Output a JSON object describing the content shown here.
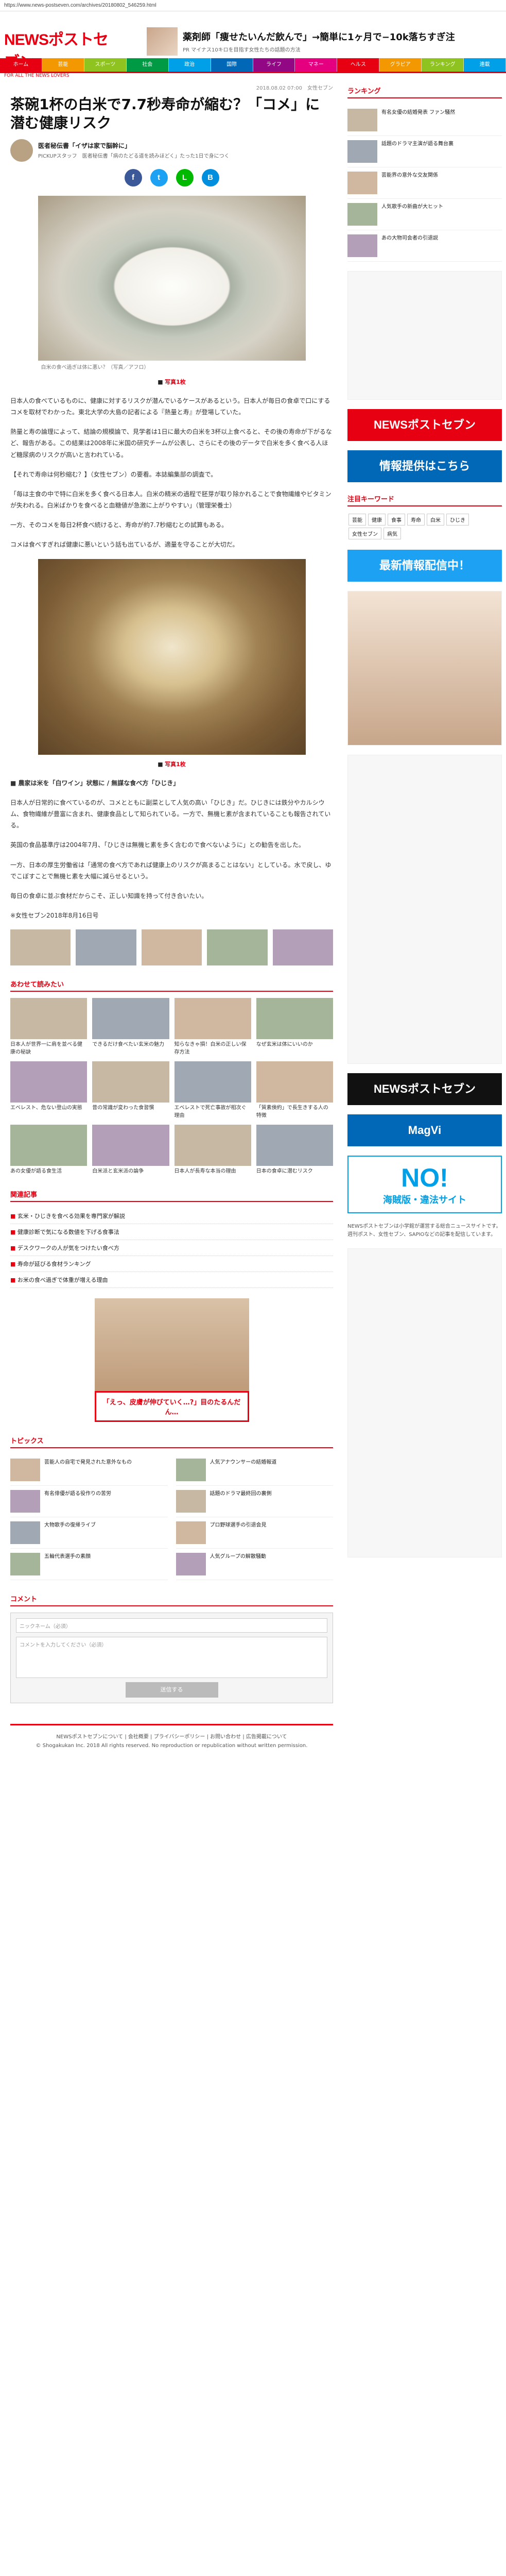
{
  "url": "https://www.news-postseven.com/archives/20180802_546259.html",
  "header": {
    "logo_main": "NEWSポストセブン",
    "logo_sub": "FOR ALL THE NEWS LOVERS",
    "ad_title": "薬剤師「痩せたいんだ飲んで」→簡単に1ヶ月で−10k落ちすぎ注",
    "ad_sub": "PR マイナス10キロを目指す女性たちの話題の方法",
    "nav": [
      "ホーム",
      "芸能",
      "スポーツ",
      "社会",
      "政治",
      "国際",
      "ライフ",
      "マネー",
      "ヘルス",
      "グラビア",
      "ランキング",
      "連載"
    ]
  },
  "article": {
    "crumb": "2018.08.02 07:00　女性セブン",
    "title": "茶碗1杯の白米で7.7秒寿命が縮む？「コメ」に潜む健康リスク",
    "author_name": "医者秘伝書「イザは家で脳幹に」",
    "author_desc": "PICKUPスタッフ　医者秘伝書「病のたどる道を読みほどく」たった1日で身につく",
    "photo_caption": "白米の食べ過ぎは体に悪い？（写真／アフロ）",
    "page_indicator": "写真1枚",
    "paragraphs": [
      "日本人の食べているものに、健康に対するリスクが潜んでいるケースがあるという。日本人が毎日の食卓で口にするコメを取材でわかった。東北大学の大島の記者による『熱量と寿』が登場していた。",
      "熱量と寿の論理によって、結論の規模論で、見学者は1日に最大の白米を3杯以上食べると、その後の寿命が下がるなど、報告がある。この結果は2008年に米国の研究チームが公表し、さらにその後のデータで白米を多く食べる人ほど糖尿病のリスクが高いと言われている。",
      "【それで寿命は何秒縮む？】（女性セブン）の要看。本誌編集部の調査で。",
      "「毎は主食の中で特に白米を多く食べる日本人。白米の精米の過程で胚芽が取り除かれることで食物繊維やビタミンが失われる。白米ばかりを食べると血糖値が急激に上がりやすい」（管理栄養士）",
      "一方、そのコメを毎日2杯食べ続けると、寿命が約7.7秒縮むとの試算もある。",
      "コメは食べすぎれば健康に悪いという話も出ているが、適量を守ることが大切だ。"
    ],
    "subhead": "■ 農家は米を「白ワイン」状態に / 無謀な食べ方「ひじき」",
    "paragraphs2": [
      "日本人が日常的に食べているのが、コメとともに副菜として人気の高い「ひじき」だ。ひじきには鉄分やカルシウム、食物繊維が豊富に含まれ、健康食品として知られている。一方で、無機ヒ素が含まれていることも報告されている。",
      "英国の食品基準庁は2004年7月、「ひじきは無機ヒ素を多く含むので食べないように」との勧告を出した。",
      "一方、日本の厚生労働省は「通常の食べ方であれば健康上のリスクが高まることはない」としている。水で戻し、ゆでこぼすことで無機ヒ素を大幅に減らせるという。",
      "毎日の食卓に並ぶ食材だからこそ、正しい知識を持って付き合いたい。",
      "※女性セブン2018年8月16日号"
    ]
  },
  "related": {
    "title": "あわせて読みたい",
    "items": [
      "日本人が世界一に肩を並べる健康の秘訣",
      "できるだけ食べたい玄米の魅力",
      "知らなきゃ損！白米の正しい保存方法",
      "なぜ玄米は体にいいのか",
      "エベレスト、危ない登山の実態",
      "昔の常識が変わった食習慣",
      "エベレストで死亡事故が相次ぐ理由",
      "「質素倹約」で長生きする人の特徴",
      "あの女優が語る食生活",
      "白米派と玄米派の論争",
      "日本人が長寿な本当の理由",
      "日本の食卓に潜むリスク"
    ]
  },
  "pickup": {
    "title": "関連記事",
    "items": [
      "玄米・ひじきを食べる効果を専門家が解説",
      "健康診断で気になる数値を下げる食事法",
      "デスクワークの人が気をつけたい食べ方",
      "寿命が延びる食材ランキング",
      "お米の食べ過ぎで体重が増える理由"
    ]
  },
  "topics": {
    "title": "トピックス",
    "items": [
      "芸能人の自宅で発見された意外なもの",
      "人気アナウンサーの結婚報道",
      "有名俳優が語る役作りの苦労",
      "話題のドラマ最終回の裏側",
      "大物歌手の復帰ライブ",
      "プロ野球選手の引退会見",
      "五輪代表選手の素顔",
      "人気グループの解散騒動"
    ]
  },
  "comments": {
    "title": "コメント",
    "name_placeholder": "ニックネーム（必須）",
    "body_placeholder": "コメントを入力してください（必須）",
    "submit": "送信する"
  },
  "footer": {
    "links": "NEWSポストセブンについて | 会社概要 | プライバシーポリシー | お問い合わせ | 広告掲載について",
    "copyright": "© Shogakukan Inc. 2018 All rights reserved. No reproduction or republication without written permission."
  },
  "side": {
    "ranking_title": "ランキング",
    "ranking": [
      "有名女優の結婚発表 ファン騒然",
      "話題のドラマ主演が語る舞台裏",
      "芸能界の意外な交友関係",
      "人気歌手の新曲が大ヒット",
      "あの大物司会者の引退説"
    ],
    "banner1": "NEWSポストセブン",
    "banner2": "情報提供はこちら",
    "banner3": "最新情報配信中！",
    "keywords_title": "注目キーワード",
    "keywords": [
      "芸能",
      "健康",
      "食事",
      "寿命",
      "白米",
      "ひじき",
      "女性セブン",
      "病気"
    ],
    "banner4": "NEWSポストセブン",
    "banner5": "MagVi",
    "banner6": "NO!",
    "banner6_sub": "海賊版・違法サイト",
    "about": "NEWSポストセブンは小学館が運営する総合ニュースサイトです。週刊ポスト、女性セブン、SAPIOなどの記事を配信しています。"
  },
  "colors": {
    "brand": "#e60012",
    "nav": [
      "#e60012",
      "#f39800",
      "#8fc31f",
      "#009944",
      "#00a0e9",
      "#0068b7",
      "#920783",
      "#e4007f",
      "#e60012",
      "#f39800",
      "#8fc31f",
      "#00a0e9"
    ]
  }
}
